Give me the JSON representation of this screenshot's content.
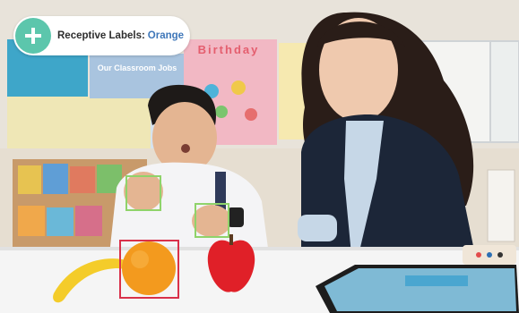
{
  "overlay": {
    "label": "Receptive Labels:",
    "value": "Orange",
    "accent_color": "#5cc6ac",
    "value_color": "#3f77b9",
    "icon": "plus-icon"
  },
  "classroom_sign": "Our Classroom Jobs",
  "birthday_banner": "Birthday",
  "colors": {
    "hand_box": "#8fd36a",
    "target_box": "#d9314a"
  }
}
